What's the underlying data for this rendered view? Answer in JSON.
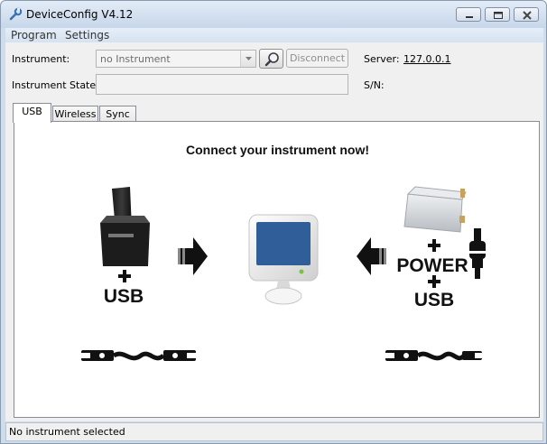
{
  "window": {
    "title": "DeviceConfig V4.12"
  },
  "menu": {
    "items": [
      "Program",
      "Settings"
    ]
  },
  "form": {
    "instrument_label": "Instrument:",
    "instrument_value": "no Instrument",
    "disconnect_label": "Disconnect",
    "server_label": "Server:",
    "server_value": "127.0.0.1",
    "state_label": "Instrument State:",
    "state_value": "",
    "sn_label": "S/N:",
    "sn_value": ""
  },
  "tabs": [
    {
      "label": "USB",
      "active": true
    },
    {
      "label": "Wireless",
      "active": false
    },
    {
      "label": "Sync",
      "active": false
    }
  ],
  "panel": {
    "headline": "Connect your instrument now!",
    "left_caption": "USB",
    "right_power_caption": "POWER",
    "right_usb_caption": "USB",
    "plus_sign": "+"
  },
  "status": {
    "text": "No instrument selected"
  },
  "colors": {
    "titlebar": "#cfdcec",
    "screen_blue": "#2f5e99",
    "arrow": "#111111"
  }
}
